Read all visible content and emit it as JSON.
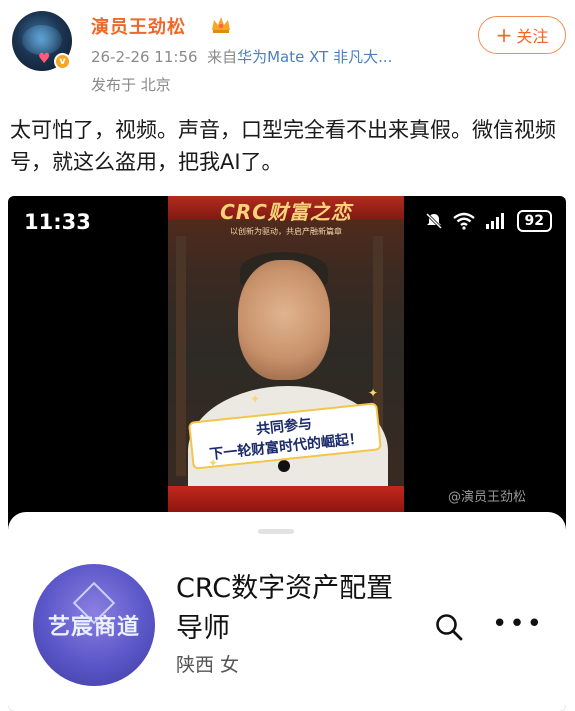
{
  "post": {
    "username": "演员王劲松",
    "timestamp": "26-2-26 11:56",
    "source_prefix": "来自",
    "device": "华为Mate XT 非凡大...",
    "location": "发布于 北京",
    "follow_label": "关注",
    "text": "太可怕了，视频。声音，口型完全看不出来真假。微信视频号，就这么盗用，把我AI了。",
    "verified_badge": "v",
    "icons": [
      "crown-icon",
      "verified-badge-icon",
      "plus-icon"
    ]
  },
  "screenshot": {
    "status_time": "11:33",
    "battery": "92",
    "video": {
      "banner_title": "CRC财富之恋",
      "subline": "以创新为驱动，共启产融新篇章",
      "caption_line1": "共同参与",
      "caption_line2": "下一轮财富时代的崛起！"
    },
    "account": {
      "logo_text": "艺宸商道",
      "name": "CRC数字资产配置导师",
      "sub": "陕西 女"
    },
    "watermark": "@演员王劲松",
    "icons": [
      "mute-icon",
      "wifi-icon",
      "signal-icon",
      "battery-icon",
      "search-icon",
      "more-icon"
    ]
  },
  "colors": {
    "accent": "#f0672a",
    "device_link": "#4a7fbf",
    "meta": "#8a8a8a"
  }
}
